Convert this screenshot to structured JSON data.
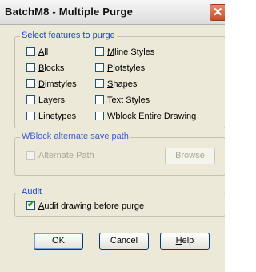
{
  "window": {
    "title": "BatchM8 - Multiple Purge",
    "close_label": "✕"
  },
  "features_group": {
    "label": "Select features to purge",
    "left": [
      {
        "mnemonic": "A",
        "rest": "ll",
        "checked": false
      },
      {
        "mnemonic": "B",
        "rest": "locks",
        "checked": false
      },
      {
        "mnemonic": "D",
        "rest": "imstyles",
        "checked": false
      },
      {
        "mnemonic": "L",
        "rest": "ayers",
        "checked": false
      },
      {
        "mnemonic": "L",
        "rest": "inetypes",
        "checked": false
      }
    ],
    "right": [
      {
        "mnemonic": "M",
        "rest": "line Styles",
        "checked": false
      },
      {
        "mnemonic": "P",
        "rest": "lotstyles",
        "checked": false
      },
      {
        "mnemonic": "S",
        "rest": "hapes",
        "checked": false
      },
      {
        "mnemonic": "T",
        "rest": "ext Styles",
        "checked": false
      },
      {
        "mnemonic": "W",
        "rest": "block Entire Drawing",
        "checked": false
      }
    ]
  },
  "wblock_group": {
    "label": "WBlock alternate save path",
    "alt_path_label": "Alternate Path",
    "browse_label": "Browse"
  },
  "audit_group": {
    "label": "Audit",
    "mnemonic": "A",
    "rest": "udit drawing before purge",
    "checked": true
  },
  "buttons": {
    "ok": "OK",
    "cancel": "Cancel",
    "help_mnemonic": "H",
    "help_rest": "elp"
  }
}
